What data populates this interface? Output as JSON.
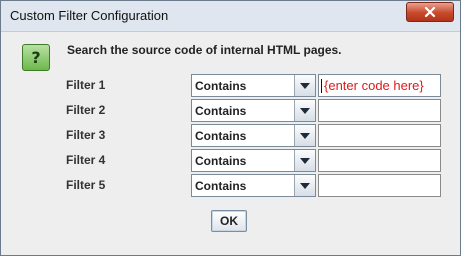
{
  "window": {
    "title": "Custom Filter Configuration"
  },
  "dialog": {
    "description": "Search the source code of internal HTML pages.",
    "help_icon_glyph": "?",
    "ok_label": "OK"
  },
  "filters": [
    {
      "label": "Filter 1",
      "condition": "Contains",
      "value": "{enter code here}"
    },
    {
      "label": "Filter 2",
      "condition": "Contains",
      "value": ""
    },
    {
      "label": "Filter 3",
      "condition": "Contains",
      "value": ""
    },
    {
      "label": "Filter 4",
      "condition": "Contains",
      "value": ""
    },
    {
      "label": "Filter 5",
      "condition": "Contains",
      "value": ""
    }
  ],
  "icons": {
    "close": "close-icon",
    "help": "help-icon",
    "dropdown": "chevron-down-icon"
  },
  "colors": {
    "placeholder_text": "#e0191b",
    "close_button": "#c84a2c",
    "help_icon": "#6cb94c"
  }
}
